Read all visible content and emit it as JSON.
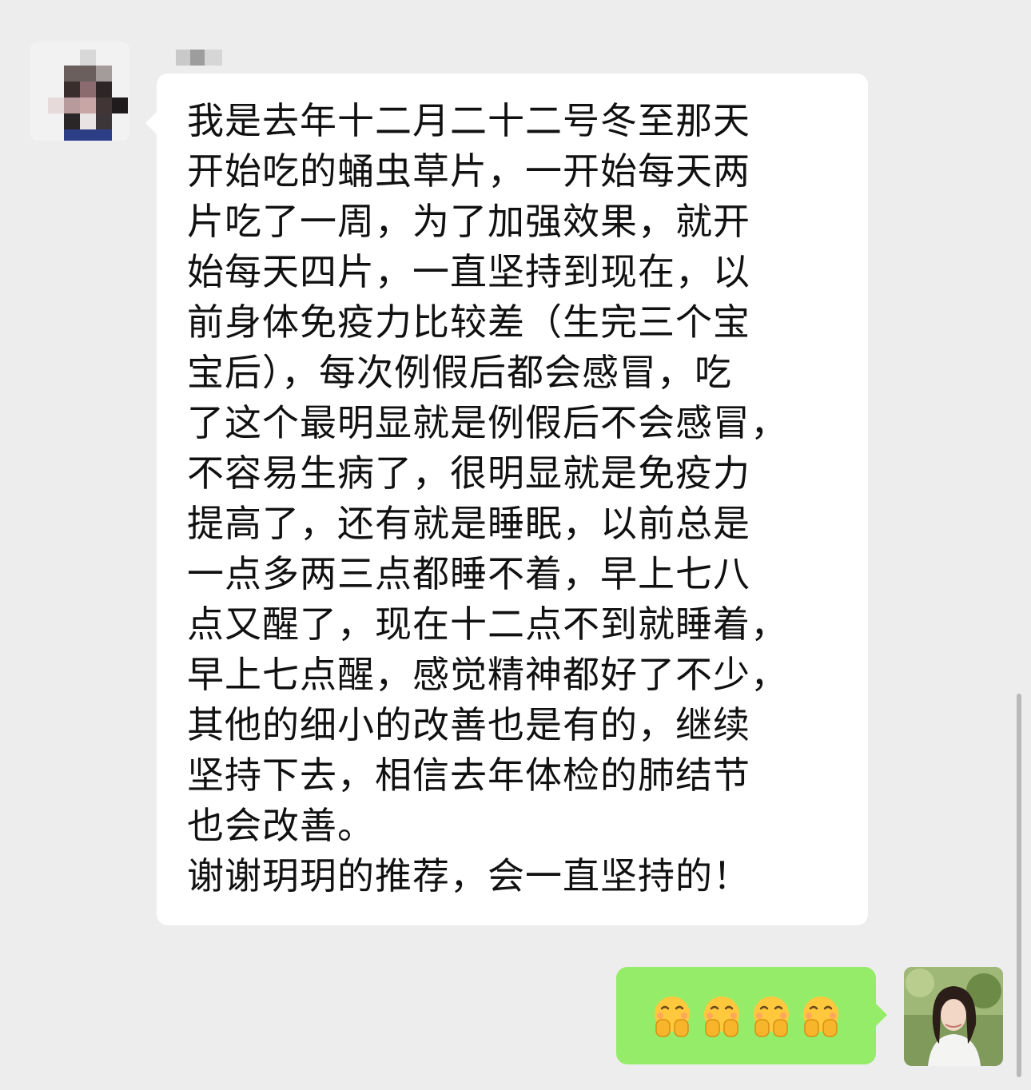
{
  "chat": {
    "received": {
      "sender_avatar": "contact-avatar-pixelated",
      "message": "我是去年十二月二十二号冬至那天\n开始吃的蛹虫草片，一开始每天两\n片吃了一周，为了加强效果，就开\n始每天四片，一直坚持到现在，以\n前身体免疫力比较差（生完三个宝\n宝后），每次例假后都会感冒，吃\n了这个最明显就是例假后不会感冒，\n不容易生病了，很明显就是免疫力\n提高了，还有就是睡眠，以前总是\n一点多两三点都睡不着，早上七八\n点又醒了，现在十二点不到就睡着，\n早上七点醒，感觉精神都好了不少，\n其他的细小的改善也是有的，继续\n坚持下去，相信去年体检的肺结节\n也会改善。\n谢谢玥玥的推荐，会一直坚持的！"
    },
    "sent": {
      "emojis": [
        "hand-over-mouth-emoji",
        "hand-over-mouth-emoji",
        "hand-over-mouth-emoji",
        "hand-over-mouth-emoji"
      ],
      "bubble_color": "#95ec69",
      "own_avatar": "user-photo-avatar"
    },
    "colors": {
      "background": "#ededed",
      "received_bubble": "#ffffff",
      "text": "#111111"
    }
  }
}
